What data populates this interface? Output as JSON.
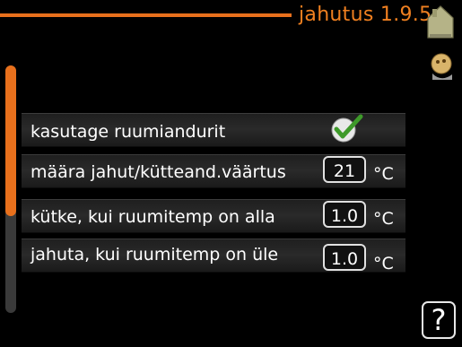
{
  "header": {
    "title": "jahutus 1.9.5"
  },
  "icons": {
    "home": "home-icon",
    "user": "user-icon",
    "checkbox": "checkmark-icon",
    "help": "help-icon"
  },
  "colors": {
    "accent": "#e8701c",
    "background": "#000000",
    "text": "#ffffff"
  },
  "settings": [
    {
      "label": "kasutage ruumiandurit",
      "checked": true
    },
    {
      "label": "määra jahut/kütteand.väärtus",
      "value": "21",
      "unit": "°C"
    },
    {
      "label": "kütke, kui ruumitemp on alla",
      "value": "1.0",
      "unit": "°C"
    },
    {
      "label": "jahuta, kui ruumitemp on üle",
      "value": "1.0",
      "unit": "°C"
    }
  ],
  "help": {
    "label": "?"
  }
}
